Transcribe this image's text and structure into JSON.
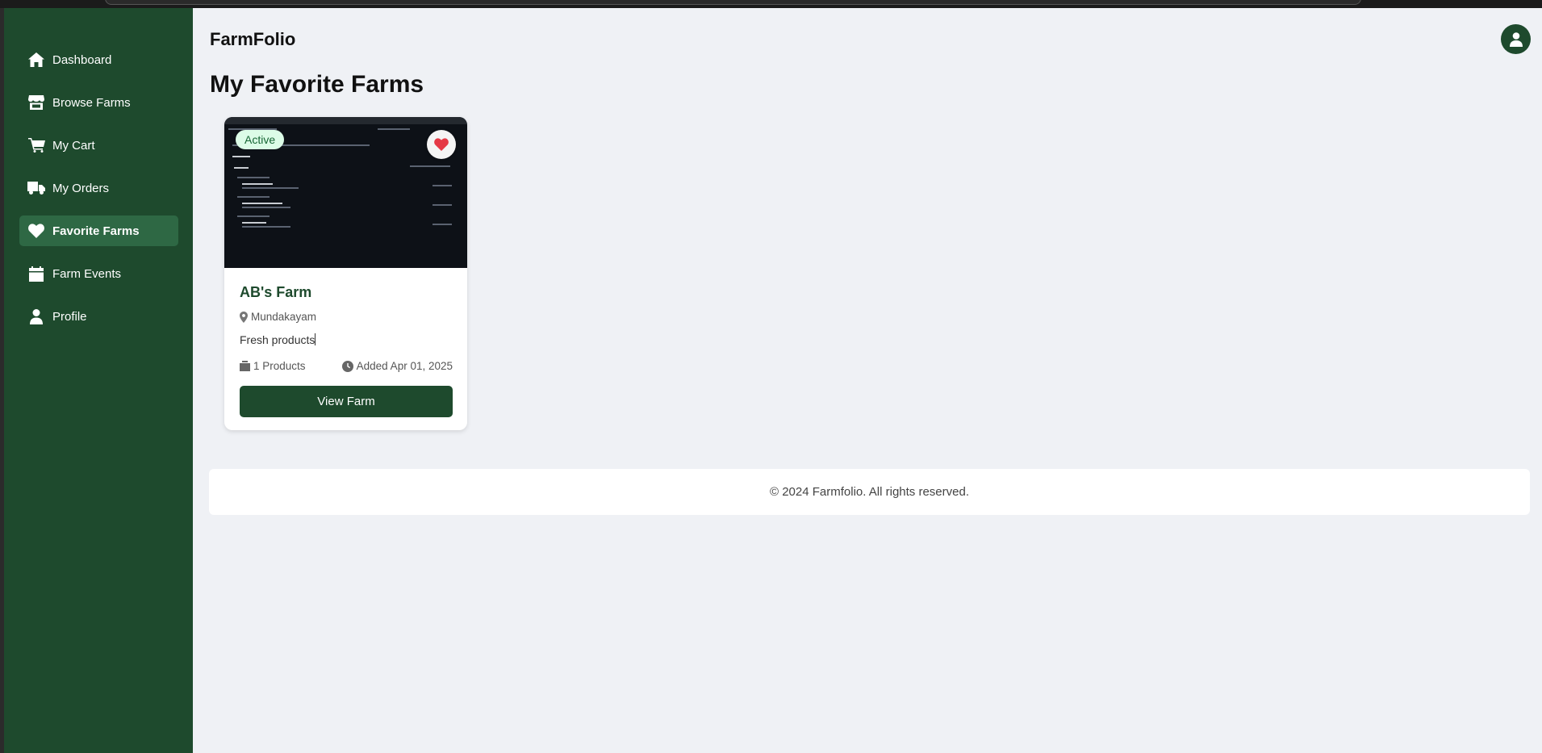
{
  "sidebar": {
    "items": [
      {
        "label": "Dashboard",
        "icon": "home-icon"
      },
      {
        "label": "Browse Farms",
        "icon": "store-icon"
      },
      {
        "label": "My Cart",
        "icon": "cart-icon"
      },
      {
        "label": "My Orders",
        "icon": "truck-icon"
      },
      {
        "label": "Favorite Farms",
        "icon": "heart-icon",
        "active": true
      },
      {
        "label": "Farm Events",
        "icon": "calendar-icon"
      },
      {
        "label": "Profile",
        "icon": "user-icon"
      }
    ]
  },
  "header": {
    "brand": "FarmFolio",
    "avatar_icon": "user-circle-icon"
  },
  "main": {
    "title": "My Favorite Farms",
    "farms": [
      {
        "status": "Active",
        "name": "AB's Farm",
        "location": "Mundakayam",
        "description": "Fresh products",
        "products": "1 Products",
        "added": "Added Apr 01, 2025",
        "button": "View Farm",
        "favorited": true
      }
    ]
  },
  "footer": {
    "text": "© 2024 Farmfolio. All rights reserved."
  },
  "colors": {
    "sidebar_bg": "#1e4a2d",
    "active_item_bg": "#2e6844",
    "page_bg": "#eff1f5",
    "heart": "#e53945",
    "badge_bg": "#dcfce7",
    "badge_text": "#166534"
  }
}
